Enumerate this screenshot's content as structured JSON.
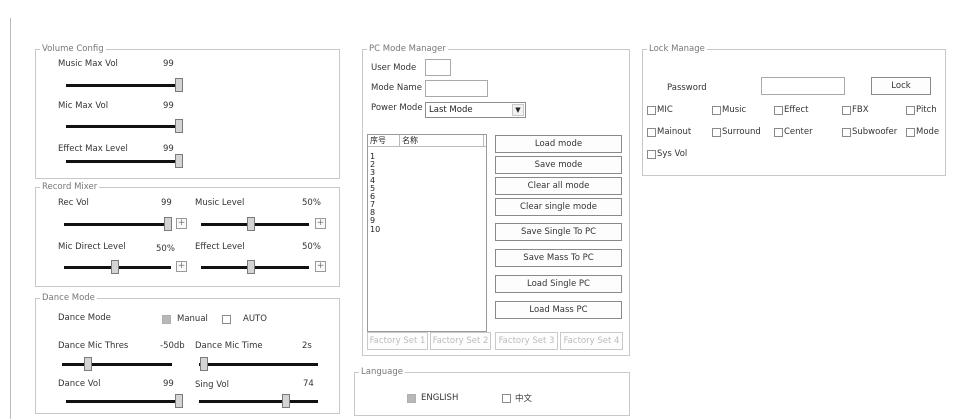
{
  "volume_config": {
    "title": "Volume Config",
    "music_max_vol": {
      "label": "Music Max Vol",
      "value": "99",
      "level": 99
    },
    "mic_max_vol": {
      "label": "Mic Max Vol",
      "value": "99",
      "level": 99
    },
    "effect_max_level": {
      "label": "Effect Max Level",
      "value": "99",
      "level": 99
    }
  },
  "record_mixer": {
    "title": "Record Mixer",
    "rec_vol": {
      "label": "Rec Vol",
      "value": "99",
      "level": 99
    },
    "music_level": {
      "label": "Music Level",
      "value": "50%",
      "level": 50
    },
    "mic_direct_level": {
      "label": "Mic Direct Level",
      "value": "50%",
      "level": 50
    },
    "effect_level": {
      "label": "Effect Level",
      "value": "50%",
      "level": 50
    },
    "plus": "+"
  },
  "dance_mode": {
    "title": "Dance Mode",
    "mode_label": "Dance Mode",
    "manual_label": "Manual",
    "auto_label": "AUTO",
    "manual_checked": true,
    "auto_checked": false,
    "mic_thres": {
      "label": "Dance Mic Thres",
      "value": "-50db"
    },
    "mic_time": {
      "label": "Dance Mic Time",
      "value": "2s"
    },
    "dance_vol": {
      "label": "Dance Vol",
      "value": "99",
      "level": 99
    },
    "sing_vol": {
      "label": "Sing Vol",
      "value": "74",
      "level": 74
    }
  },
  "pc_mode_manager": {
    "title": "PC Mode Manager",
    "user_mode_label": "User Mode",
    "user_mode_value": "",
    "mode_name_label": "Mode Name",
    "mode_name_value": "",
    "power_mode_label": "Power Mode",
    "power_mode_value": "Last Mode",
    "list_headers": [
      "序号",
      "名称"
    ],
    "list_rows": [
      "1",
      "2",
      "3",
      "4",
      "5",
      "6",
      "7",
      "8",
      "9",
      "10"
    ],
    "buttons": {
      "load_mode": "Load mode",
      "save_mode": "Save mode",
      "clear_all_mode": "Clear all mode",
      "clear_single_mode": "Clear single mode",
      "save_single_to_pc": "Save Single To PC",
      "save_mass_to_pc": "Save Mass To PC",
      "load_single_pc": "Load Single PC",
      "load_mass_pc": "Load Mass PC"
    },
    "factory": [
      "Factory Set 1",
      "Factory Set 2",
      "Factory Set 3",
      "Factory Set 4"
    ]
  },
  "language": {
    "title": "Language",
    "english": "ENGLISH",
    "chinese": "中文",
    "english_checked": true,
    "chinese_checked": false
  },
  "lock_manage": {
    "title": "Lock Manage",
    "password_label": "Password",
    "password_value": "",
    "lock_button": "Lock",
    "checks": [
      "MIC",
      "Music",
      "Effect",
      "FBX",
      "Pitch",
      "Mainout",
      "Surround",
      "Center",
      "Subwoofer",
      "Mode",
      "Sys Vol"
    ]
  },
  "colors": {
    "slider_track": "#111111",
    "thumb": "#d4d4d4",
    "border": "#c8c8c8"
  }
}
